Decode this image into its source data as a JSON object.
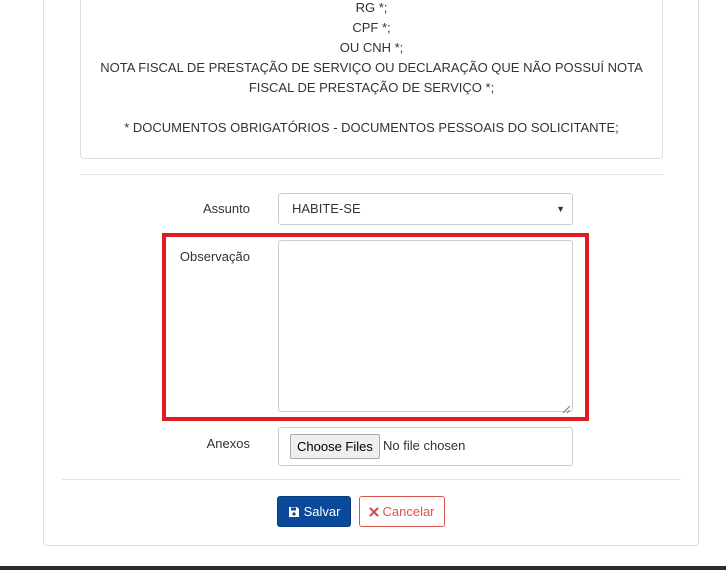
{
  "info": {
    "lines": [
      "RG *;",
      "CPF *;",
      "OU CNH *;",
      "NOTA FISCAL DE PRESTAÇÃO DE SERVIÇO OU DECLARAÇÃO QUE NÃO POSSUÍ NOTA",
      "FISCAL DE PRESTAÇÃO DE SERVIÇO *;",
      "* DOCUMENTOS OBRIGATÓRIOS - DOCUMENTOS PESSOAIS DO SOLICITANTE;"
    ]
  },
  "form": {
    "assunto_label": "Assunto",
    "assunto_value": "HABITE-SE",
    "observacao_label": "Observação",
    "observacao_value": "",
    "anexos_label": "Anexos",
    "file_button_label": "Choose Files",
    "file_status": "No file chosen"
  },
  "actions": {
    "save_label": "Salvar",
    "save_icon": "floppy-disk-icon",
    "cancel_label": "Cancelar",
    "cancel_icon": "close-icon"
  },
  "colors": {
    "primary": "#0b4a9b",
    "danger": "#d9534f",
    "highlight": "#e01b24"
  }
}
